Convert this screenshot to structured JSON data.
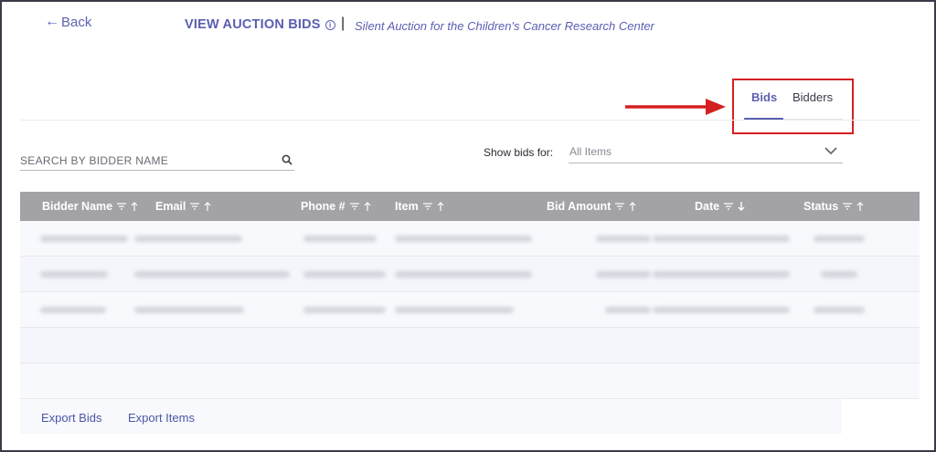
{
  "header": {
    "back_label": "Back",
    "page_title": "VIEW AUCTION BIDS",
    "separator": "|",
    "auction_name": "Silent Auction for the Children's Cancer Research Center"
  },
  "tabs": {
    "bids_label": "Bids",
    "bidders_label": "Bidders",
    "active": "Bids"
  },
  "search": {
    "placeholder": "SEARCH BY BIDDER NAME",
    "value": ""
  },
  "filter": {
    "label": "Show bids for:",
    "selected": "All Items"
  },
  "table": {
    "columns": [
      {
        "label": "Bidder Name",
        "sort": "asc"
      },
      {
        "label": "Email",
        "sort": "asc"
      },
      {
        "label": "Phone #",
        "sort": "asc"
      },
      {
        "label": "Item",
        "sort": "asc"
      },
      {
        "label": "Bid Amount",
        "sort": "asc"
      },
      {
        "label": "Date",
        "sort": "desc"
      },
      {
        "label": "Status",
        "sort": "asc"
      }
    ],
    "redacted_rows": 3,
    "empty_rows": 2
  },
  "footer": {
    "export_bids": "Export Bids",
    "export_items": "Export Items"
  },
  "colors": {
    "accent": "#5b5fb0",
    "header_bg": "#a3a3a7",
    "highlight_red": "#d42020"
  }
}
